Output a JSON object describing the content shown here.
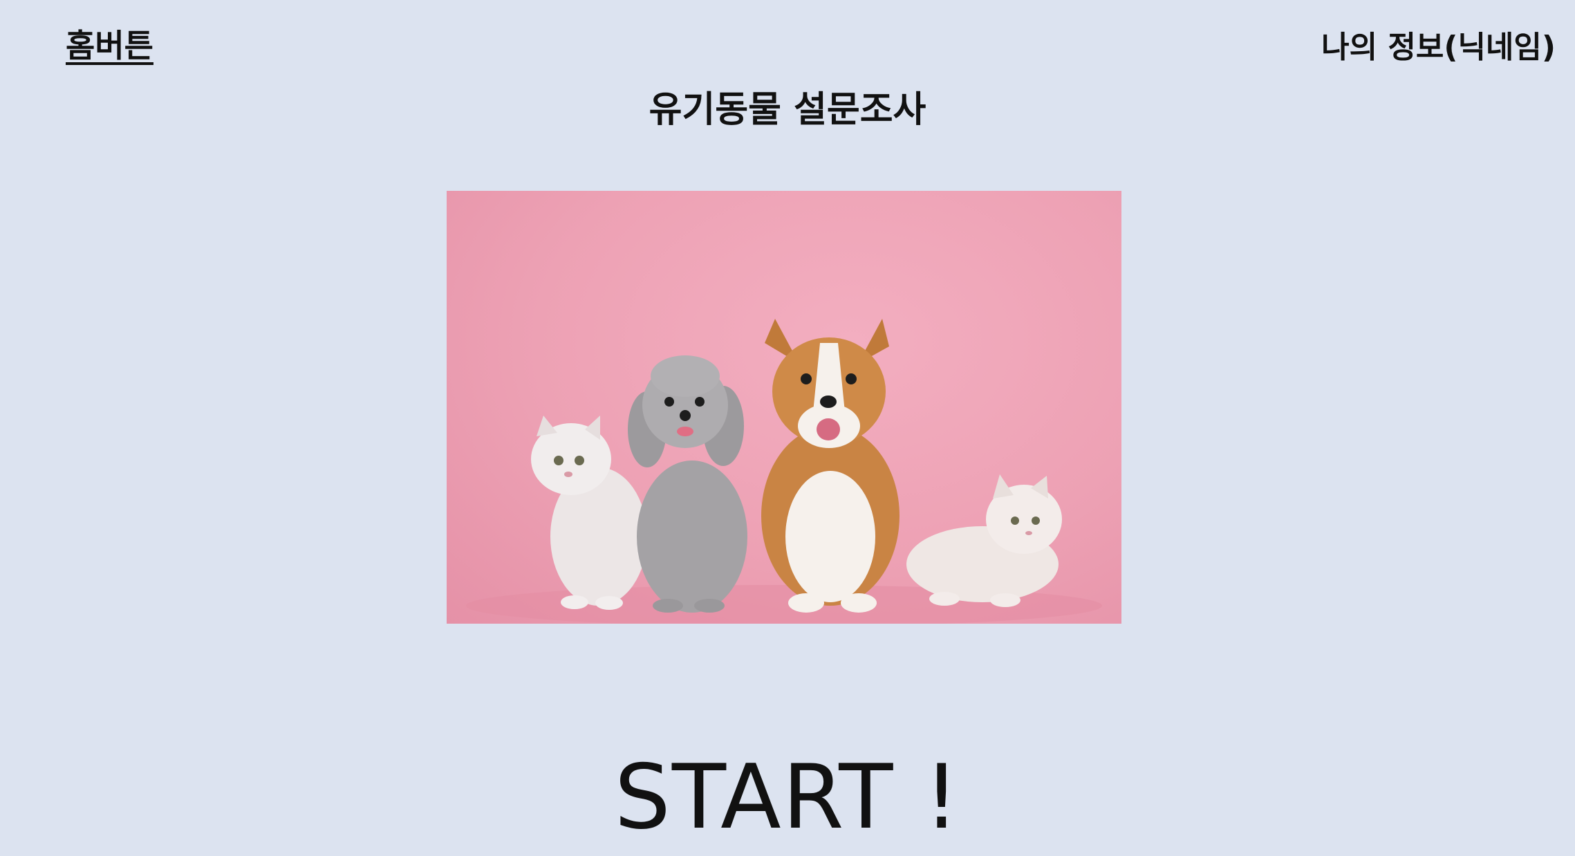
{
  "header": {
    "home_label": "홈버튼",
    "profile_label": "나의 정보(닉네임)"
  },
  "main": {
    "title": "유기동물 설문조사",
    "start_label": "START !"
  },
  "colors": {
    "background": "#dce3f0",
    "hero_pink": "#eda1b4"
  }
}
